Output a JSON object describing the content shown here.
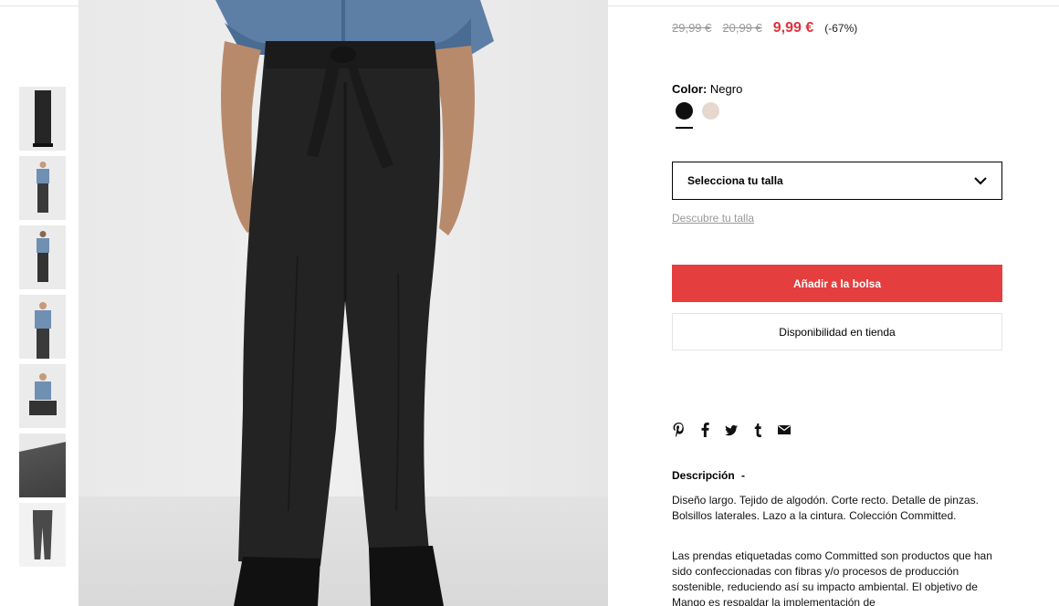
{
  "product": {
    "old_price_1": "29,99 €",
    "old_price_2": "20,99 €",
    "sale_price": "9,99 €",
    "discount": "(-67%)"
  },
  "color": {
    "label": "Color:",
    "value": "Negro",
    "swatches": [
      "#0f0f0f",
      "#e6d7cf"
    ],
    "selected_index": 0
  },
  "size": {
    "placeholder": "Selecciona tu talla",
    "guide_link": "Descubre tu talla"
  },
  "actions": {
    "add_to_bag": "Añadir a la bolsa",
    "store_availability": "Disponibilidad en tienda"
  },
  "share_icons": [
    "pinterest-icon",
    "facebook-icon",
    "twitter-icon",
    "tumblr-icon",
    "email-icon"
  ],
  "description": {
    "title": "Descripción",
    "toggle": "-",
    "paragraph_1": "Diseño largo. Tejido de algodón. Corte recto. Detalle de pinzas. Bolsillos laterales. Lazo a la cintura. Colección Committed.",
    "paragraph_2": "Las prendas etiquetadas como Committed son productos que han sido confeccionadas con fibras y/o procesos de producción sostenible, reduciendo así su impacto ambiental. El objetivo de Mango es respaldar la implementación de"
  },
  "gallery": {
    "thumbnail_count": 7,
    "active_index": 0
  },
  "colors": {
    "accent": "#e53e3e",
    "sale": "#e0313d"
  }
}
